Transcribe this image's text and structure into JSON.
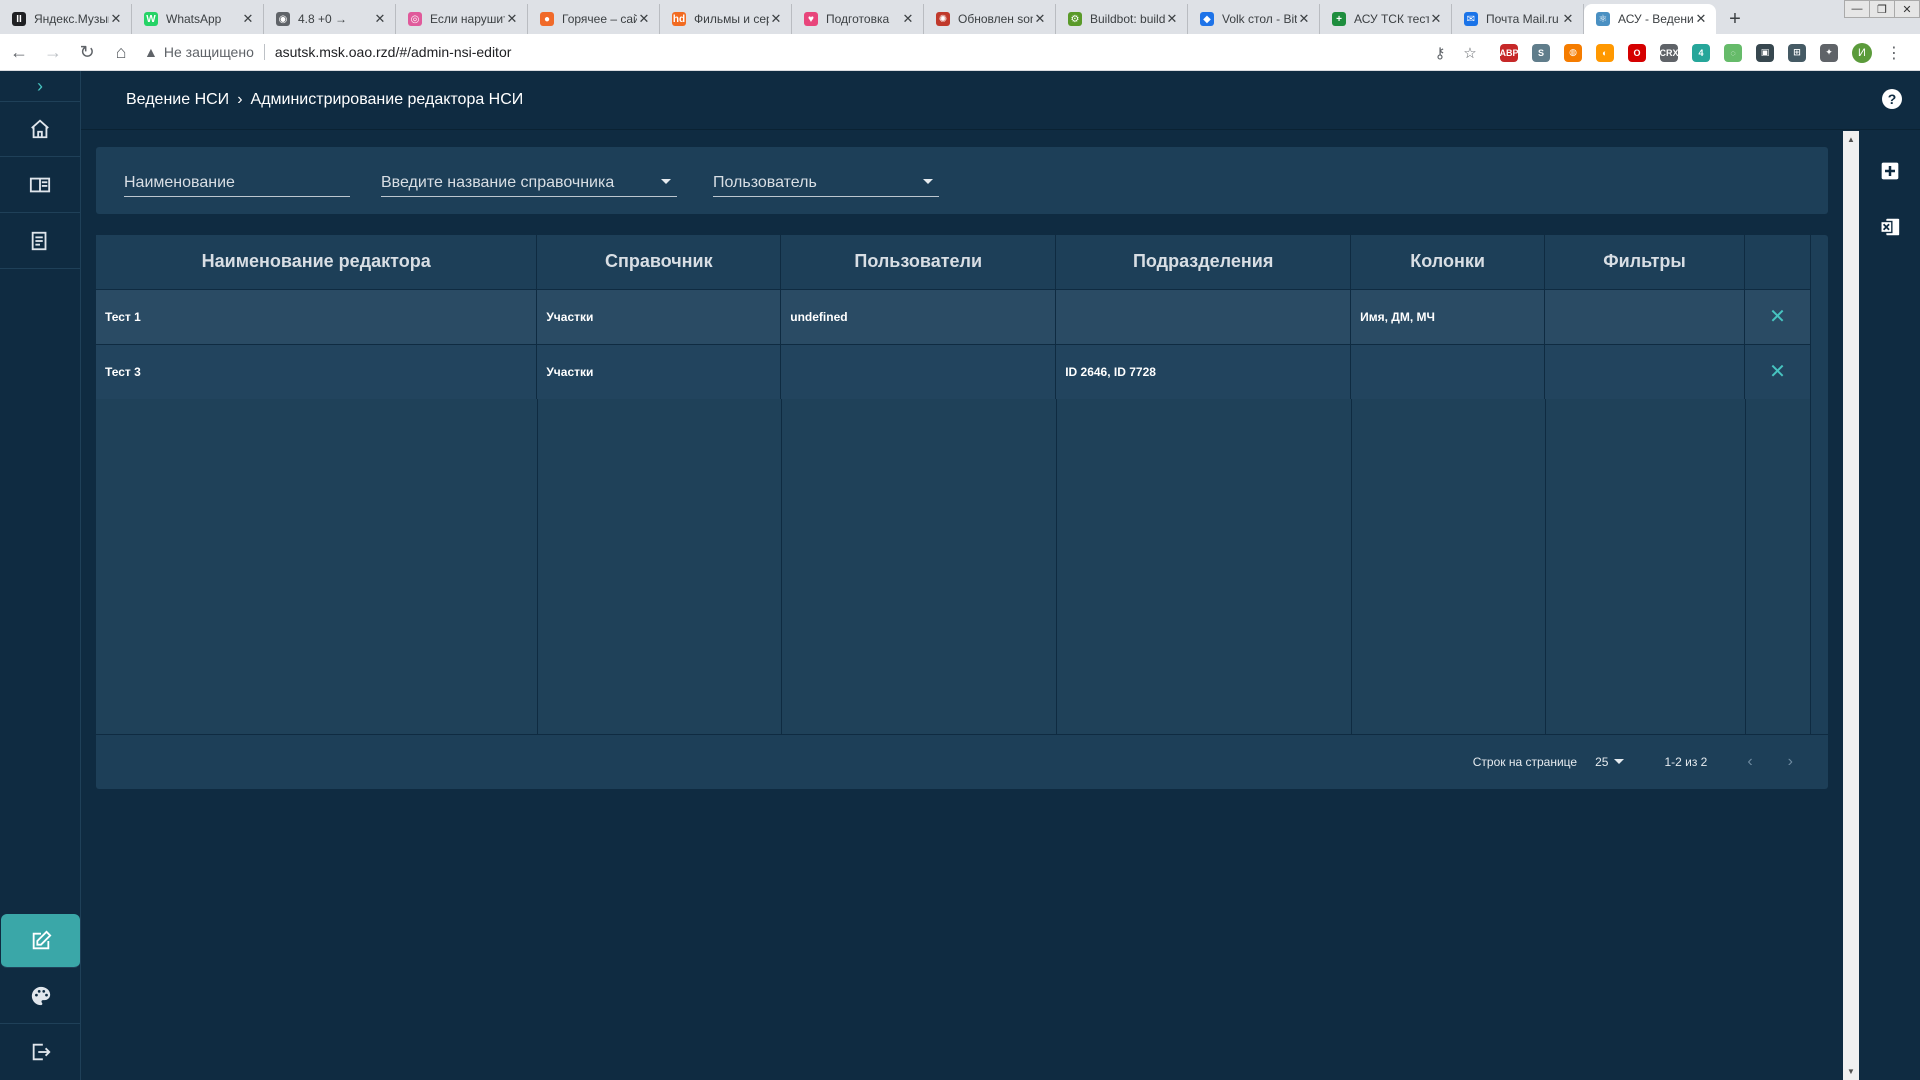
{
  "browser": {
    "tabs": [
      {
        "title": "Яндекс.Музыка",
        "icon_color": "#202124",
        "icon_glyph": "II"
      },
      {
        "title": "WhatsApp",
        "icon_color": "#25d366",
        "icon_glyph": "W"
      },
      {
        "title": "4.8 +0 →",
        "icon_color": "#5f6368",
        "icon_glyph": "◉"
      },
      {
        "title": "Если нарушите",
        "icon_color": "#e05a9b",
        "icon_glyph": "◎"
      },
      {
        "title": "Горячее – сайт",
        "icon_color": "#f06a2a",
        "icon_glyph": "●"
      },
      {
        "title": "Фильмы и сериалы",
        "icon_color": "#f26b21",
        "icon_glyph": "hd"
      },
      {
        "title": "Подготовка",
        "icon_color": "#e8457b",
        "icon_glyph": "♥"
      },
      {
        "title": "Обновлен sonar",
        "icon_color": "#c0392b",
        "icon_glyph": "✺"
      },
      {
        "title": "Buildbot: build",
        "icon_color": "#5a9a2a",
        "icon_glyph": "⚙"
      },
      {
        "title": "Volk стол - Bitrix",
        "icon_color": "#1e73e8",
        "icon_glyph": "◆"
      },
      {
        "title": "АСУ ТСК тест",
        "icon_color": "#1e8e3e",
        "icon_glyph": "+"
      },
      {
        "title": "Почта Mail.ru",
        "icon_color": "#1a73e8",
        "icon_glyph": "✉"
      },
      {
        "title": "АСУ - Ведение НСИ",
        "icon_color": "#4a90c2",
        "icon_glyph": "⚛"
      }
    ],
    "insecure_label": "Не защищено",
    "url": "asutsk.msk.oao.rzd/#/admin-nsi-editor",
    "profile_initial": "И",
    "extensions": [
      {
        "label": "ABP",
        "color": "#c62828"
      },
      {
        "label": "S",
        "color": "#607d8b"
      },
      {
        "label": "◍",
        "color": "#f57c00"
      },
      {
        "label": "◐",
        "color": "#ff9800"
      },
      {
        "label": "O",
        "color": "#d50000"
      },
      {
        "label": "CRX",
        "color": "#5f6368"
      },
      {
        "label": "4",
        "color": "#26a69a"
      },
      {
        "label": "◌",
        "color": "#66bb6a"
      },
      {
        "label": "▣",
        "color": "#37474f"
      },
      {
        "label": "⊞",
        "color": "#455a64"
      },
      {
        "label": "✦",
        "color": "#5f6368"
      }
    ]
  },
  "header": {
    "breadcrumb_root": "Ведение НСИ",
    "breadcrumb_current": "Администрирование редактора НСИ",
    "help_label": "?"
  },
  "filters": {
    "name_placeholder": "Наименование",
    "dictionary_placeholder": "Введите название справочника",
    "user_placeholder": "Пользователь"
  },
  "table": {
    "columns": [
      "Наименование редактора",
      "Справочник",
      "Пользователи",
      "Подразделения",
      "Колонки",
      "Фильтры",
      ""
    ],
    "rows": [
      {
        "name": "Тест 1",
        "dictionary": "Участки",
        "users": "undefined",
        "departments": "",
        "columns": "Имя, ДМ, МЧ",
        "filters": ""
      },
      {
        "name": "Тест 3",
        "dictionary": "Участки",
        "users": "",
        "departments": "ID 2646, ID 7728",
        "columns": "",
        "filters": ""
      }
    ]
  },
  "pager": {
    "rows_per_page_label": "Строк на странице",
    "rows_per_page_value": "25",
    "range_label": "1-2 из 2"
  },
  "colors": {
    "background": "#0f2b41",
    "card": "#1d3f58",
    "accent": "#3aa7a8",
    "delete_icon": "#47c4c0"
  }
}
